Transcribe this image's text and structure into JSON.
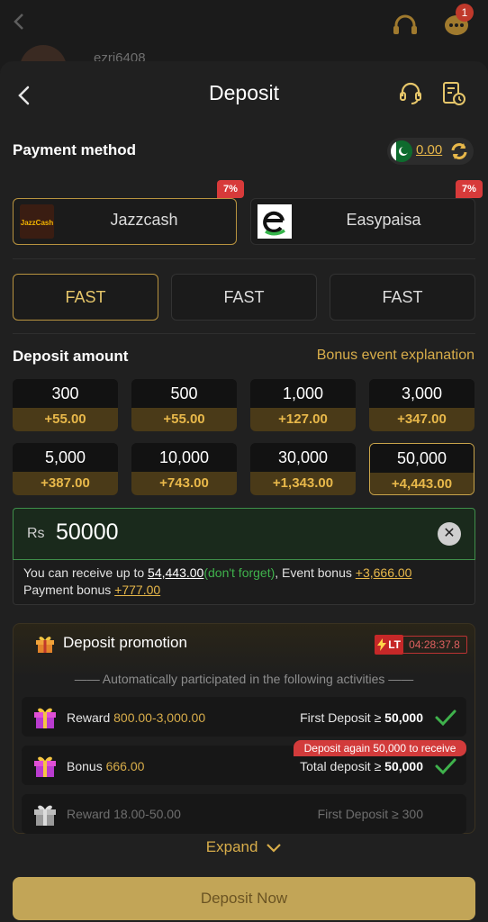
{
  "background": {
    "username": "ezri6408",
    "notification_count": "1"
  },
  "header": {
    "title": "Deposit"
  },
  "payment": {
    "label": "Payment method",
    "balance": "0.00",
    "methods": [
      {
        "name": "Jazzcash",
        "logo_text": "JazzCash",
        "tag": "7%"
      },
      {
        "name": "Easypaisa",
        "tag": "7%"
      }
    ],
    "channels": [
      "FAST",
      "FAST",
      "FAST"
    ]
  },
  "deposit": {
    "label": "Deposit amount",
    "bonus_link": "Bonus event explanation",
    "amounts": [
      {
        "amount": "300",
        "bonus": "+55.00"
      },
      {
        "amount": "500",
        "bonus": "+55.00"
      },
      {
        "amount": "1,000",
        "bonus": "+127.00"
      },
      {
        "amount": "3,000",
        "bonus": "+347.00"
      },
      {
        "amount": "5,000",
        "bonus": "+387.00"
      },
      {
        "amount": "10,000",
        "bonus": "+743.00"
      },
      {
        "amount": "30,000",
        "bonus": "+1,343.00"
      },
      {
        "amount": "50,000",
        "bonus": "+4,443.00"
      }
    ],
    "currency": "Rs",
    "input_value": "50000",
    "info": {
      "prefix": "You can receive up to ",
      "total": "54,443.00",
      "dont_forget": "(don't forget)",
      "event_label": ", Event bonus ",
      "event_bonus": "+3,666.00",
      "payment_label": "Payment bonus ",
      "payment_bonus": "+777.00"
    }
  },
  "promotion": {
    "title": "Deposit promotion",
    "lt": "LT",
    "timer": "04:28:37.8",
    "note": "—— Automatically participated in the following activities ——",
    "activities": [
      {
        "label": "Reward ",
        "value": "800.00-3,000.00",
        "req": "First Deposit ≥ ",
        "req_value": "50,000"
      },
      {
        "label": "Bonus ",
        "value": "666.00",
        "req": "Total deposit ≥ ",
        "req_value": "50,000",
        "tag": "Deposit again 50,000 to receive"
      },
      {
        "label": "Reward ",
        "value": "18.00-50.00",
        "req": "First Deposit ≥ ",
        "req_value": "300"
      }
    ]
  },
  "expand_label": "Expand",
  "deposit_button": "Deposit Now",
  "colors": {
    "gold": "#e8b84a",
    "accent_button": "#c2a557",
    "success": "#3fb24c",
    "danger": "#d73a3a"
  }
}
